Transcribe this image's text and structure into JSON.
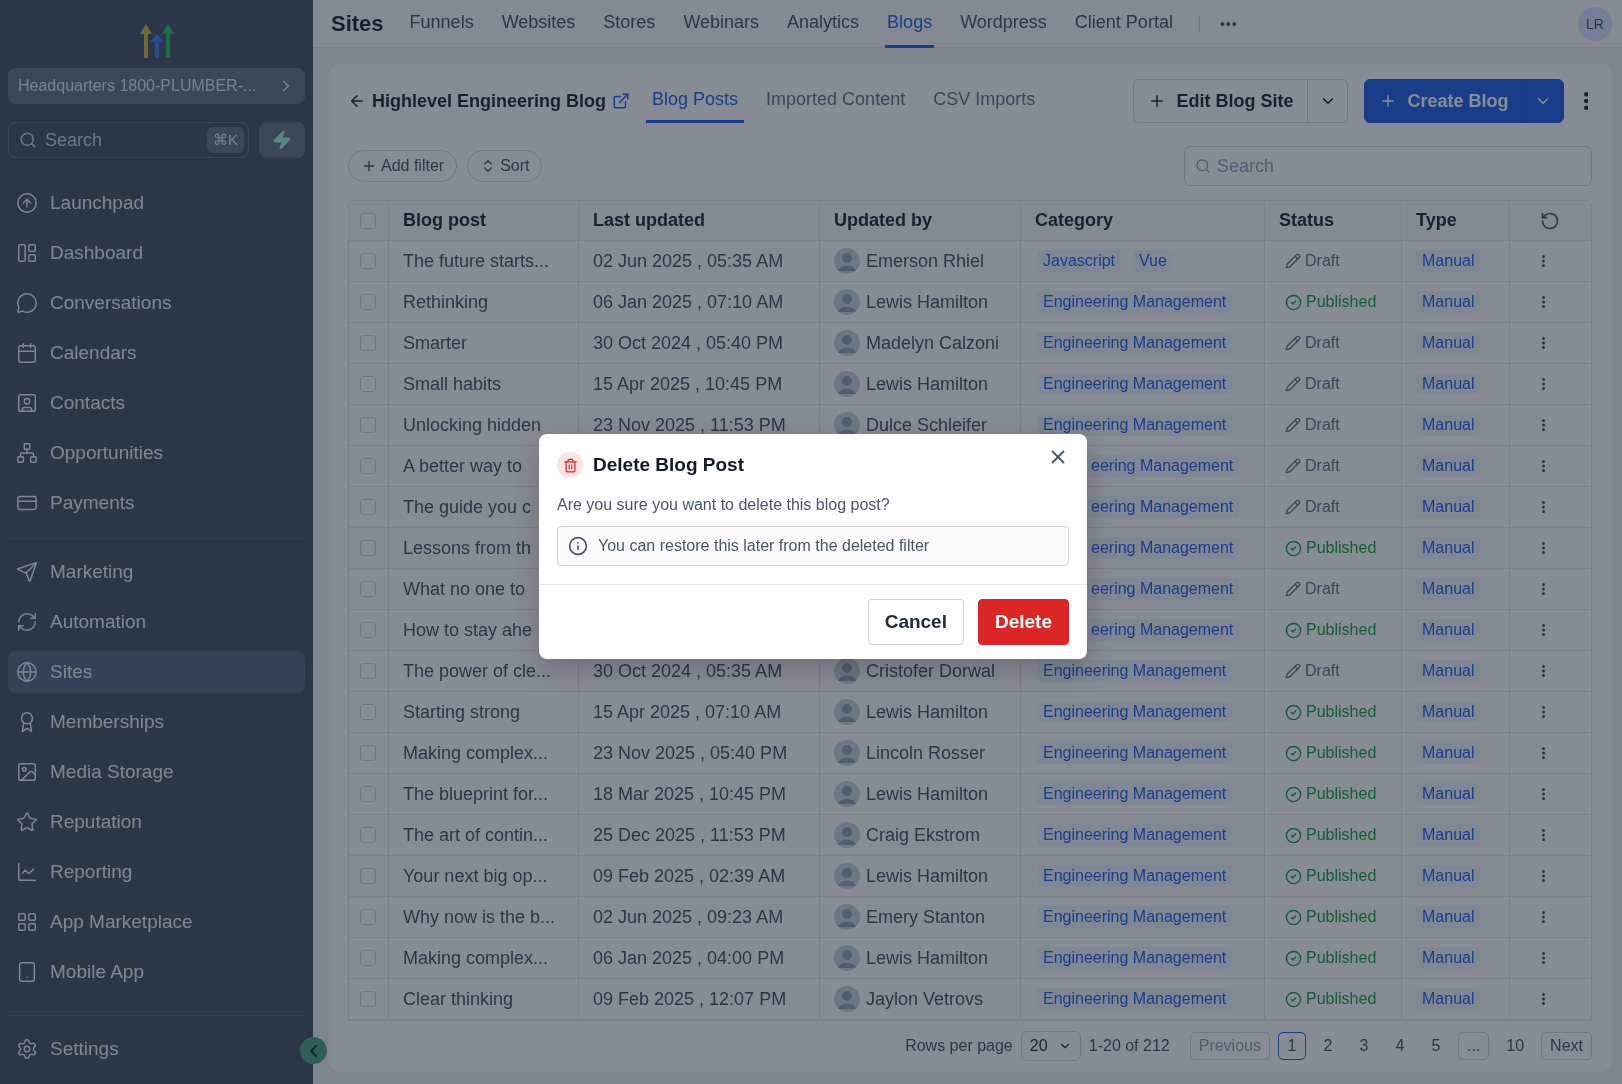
{
  "sidebar": {
    "account": "Headquarters 1800-PLUMBER-...",
    "search": {
      "placeholder": "Search",
      "shortcut": "⌘K"
    },
    "items": [
      {
        "label": "Launchpad",
        "selected": false
      },
      {
        "label": "Dashboard",
        "selected": false
      },
      {
        "label": "Conversations",
        "selected": false
      },
      {
        "label": "Calendars",
        "selected": false
      },
      {
        "label": "Contacts",
        "selected": false
      },
      {
        "label": "Opportunities",
        "selected": false
      },
      {
        "label": "Payments",
        "selected": false
      }
    ],
    "items_2": [
      {
        "label": "Marketing",
        "selected": false
      },
      {
        "label": "Automation",
        "selected": false
      },
      {
        "label": "Sites",
        "selected": true
      },
      {
        "label": "Memberships",
        "selected": false
      },
      {
        "label": "Media Storage",
        "selected": false
      },
      {
        "label": "Reputation",
        "selected": false
      },
      {
        "label": "Reporting",
        "selected": false
      },
      {
        "label": "App Marketplace",
        "selected": false
      },
      {
        "label": "Mobile App",
        "selected": false
      }
    ],
    "settings": "Settings"
  },
  "top_nav": {
    "title": "Sites",
    "tabs": [
      {
        "label": "Funnels",
        "selected": false
      },
      {
        "label": "Websites",
        "selected": false
      },
      {
        "label": "Stores",
        "selected": false
      },
      {
        "label": "Webinars",
        "selected": false
      },
      {
        "label": "Analytics",
        "selected": false
      },
      {
        "label": "Blogs",
        "selected": true
      },
      {
        "label": "Wordpress",
        "selected": false
      },
      {
        "label": "Client Portal",
        "selected": false
      }
    ],
    "more": "•••",
    "avatar": "LR"
  },
  "header": {
    "blog_title": "Highlevel Engineering Blog",
    "tabs": [
      {
        "label": "Blog Posts",
        "selected": true
      },
      {
        "label": "Imported Content",
        "selected": false
      },
      {
        "label": "CSV Imports",
        "selected": false
      }
    ],
    "edit_button": "Edit Blog Site",
    "create_button": "Create Blog"
  },
  "toolbar": {
    "add_filter": "Add filter",
    "sort": "Sort",
    "search": {
      "placeholder": "Search"
    }
  },
  "table": {
    "select_all_checked": false,
    "columns": [
      "Blog post",
      "Last updated",
      "Updated by",
      "Category",
      "Status",
      "Type"
    ],
    "rows": [
      {
        "checked": false,
        "blog_post": "The future starts...",
        "last_updated": "02 Jun 2025 , 05:35 AM",
        "updated_by": "Emerson Rhiel",
        "categories": [
          "Javascript",
          "Vue"
        ],
        "status": {
          "label": "Draft",
          "kind": "draft"
        },
        "type": "Manual"
      },
      {
        "checked": false,
        "blog_post": "Rethinking",
        "last_updated": "06 Jan 2025 , 07:10 AM",
        "updated_by": "Lewis Hamilton",
        "categories": [
          "Engineering Management"
        ],
        "status": {
          "label": "Published",
          "kind": "published"
        },
        "type": "Manual"
      },
      {
        "checked": false,
        "blog_post": "Smarter",
        "last_updated": "30 Oct 2024 , 05:40 PM",
        "updated_by": "Madelyn Calzoni",
        "categories": [
          "Engineering Management"
        ],
        "status": {
          "label": "Draft",
          "kind": "draft"
        },
        "type": "Manual"
      },
      {
        "checked": false,
        "blog_post": "Small habits",
        "last_updated": "15 Apr 2025 , 10:45 PM",
        "updated_by": "Lewis Hamilton",
        "categories": [
          "Engineering Management"
        ],
        "status": {
          "label": "Draft",
          "kind": "draft"
        },
        "type": "Manual"
      },
      {
        "checked": false,
        "blog_post": "Unlocking hidden",
        "last_updated": "23 Nov 2025 , 11:53 PM",
        "updated_by": "Dulce Schleifer",
        "categories": [
          "Engineering Management"
        ],
        "status": {
          "label": "Draft",
          "kind": "draft"
        },
        "type": "Manual"
      },
      {
        "checked": false,
        "blog_post": "A better way to",
        "categories": [
          "eering Management"
        ],
        "status": {
          "label": "Draft",
          "kind": "draft"
        },
        "type": "Manual"
      },
      {
        "checked": false,
        "blog_post": "The guide you c",
        "categories": [
          "eering Management"
        ],
        "status": {
          "label": "Draft",
          "kind": "draft"
        },
        "type": "Manual"
      },
      {
        "checked": false,
        "blog_post": "Lessons from th",
        "categories": [
          "eering Management"
        ],
        "status": {
          "label": "Published",
          "kind": "published"
        },
        "type": "Manual"
      },
      {
        "checked": false,
        "blog_post": "What no one to",
        "categories": [
          "eering Management"
        ],
        "status": {
          "label": "Draft",
          "kind": "draft"
        },
        "type": "Manual"
      },
      {
        "checked": false,
        "blog_post": "How to stay ahe",
        "categories": [
          "eering Management"
        ],
        "status": {
          "label": "Published",
          "kind": "published"
        },
        "type": "Manual"
      },
      {
        "checked": false,
        "blog_post": "The power of cle...",
        "last_updated": "30 Oct 2024 , 05:35 AM",
        "updated_by": "Cristofer Dorwal",
        "categories": [
          "Engineering Management"
        ],
        "status": {
          "label": "Draft",
          "kind": "draft"
        },
        "type": "Manual"
      },
      {
        "checked": false,
        "blog_post": "Starting strong",
        "last_updated": "15 Apr 2025 , 07:10 AM",
        "updated_by": "Lewis Hamilton",
        "categories": [
          "Engineering Management"
        ],
        "status": {
          "label": "Published",
          "kind": "published"
        },
        "type": "Manual"
      },
      {
        "checked": false,
        "blog_post": "Making complex...",
        "last_updated": "23 Nov 2025 , 05:40 PM",
        "updated_by": "Lincoln Rosser",
        "categories": [
          "Engineering Management"
        ],
        "status": {
          "label": "Published",
          "kind": "published"
        },
        "type": "Manual"
      },
      {
        "checked": false,
        "blog_post": "The blueprint for...",
        "last_updated": "18 Mar 2025 , 10:45 PM",
        "updated_by": "Lewis Hamilton",
        "categories": [
          "Engineering Management"
        ],
        "status": {
          "label": "Published",
          "kind": "published"
        },
        "type": "Manual"
      },
      {
        "checked": false,
        "blog_post": "The art of contin...",
        "last_updated": "25 Dec 2025 , 11:53 PM",
        "updated_by": "Craig Ekstrom",
        "categories": [
          "Engineering Management"
        ],
        "status": {
          "label": "Published",
          "kind": "published"
        },
        "type": "Manual"
      },
      {
        "checked": false,
        "blog_post": "Your next big op...",
        "last_updated": "09 Feb 2025 , 02:39 AM",
        "updated_by": "Lewis Hamilton",
        "categories": [
          "Engineering Management"
        ],
        "status": {
          "label": "Published",
          "kind": "published"
        },
        "type": "Manual"
      },
      {
        "checked": false,
        "blog_post": "Why now is the b...",
        "last_updated": "02 Jun 2025 , 09:23 AM",
        "updated_by": "Emery Stanton",
        "categories": [
          "Engineering Management"
        ],
        "status": {
          "label": "Published",
          "kind": "published"
        },
        "type": "Manual"
      },
      {
        "checked": false,
        "blog_post": "Making complex...",
        "last_updated": "06 Jan 2025 , 04:00 PM",
        "updated_by": "Lewis Hamilton",
        "categories": [
          "Engineering Management"
        ],
        "status": {
          "label": "Published",
          "kind": "published"
        },
        "type": "Manual"
      },
      {
        "checked": false,
        "blog_post": "Clear thinking",
        "last_updated": "09 Feb 2025 , 12:07 PM",
        "updated_by": "Jaylon Vetrovs",
        "categories": [
          "Engineering Management"
        ],
        "status": {
          "label": "Published",
          "kind": "published"
        },
        "type": "Manual"
      }
    ]
  },
  "pagination": {
    "label": "Rows per page",
    "rows_per_page": "20",
    "range": "1-20 of 212",
    "previous": {
      "label": "Previous",
      "disabled": true
    },
    "pages": [
      {
        "label": "1",
        "selected": true
      },
      {
        "label": "2",
        "selected": false
      },
      {
        "label": "3",
        "selected": false
      },
      {
        "label": "4",
        "selected": false
      },
      {
        "label": "5",
        "selected": false
      },
      {
        "label": "...",
        "selected": false
      },
      {
        "label": "10",
        "selected": false
      }
    ],
    "next": {
      "label": "Next",
      "disabled": false
    }
  },
  "dialog": {
    "title": "Delete Blog Post",
    "message": "Are you sure you want to delete this blog post?",
    "info": "You can restore this later from the deleted filter",
    "cancel": "Cancel",
    "confirm": "Delete"
  }
}
